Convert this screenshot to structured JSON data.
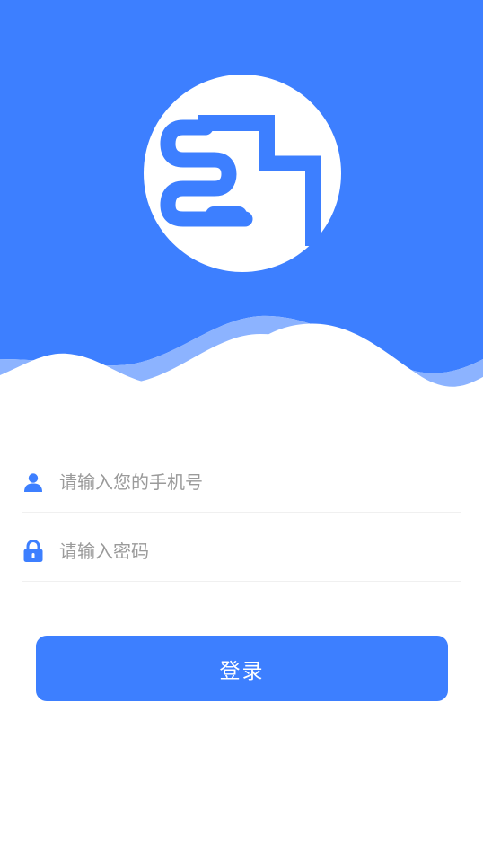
{
  "colors": {
    "primary": "#3d7fff",
    "wave_light": "#8cb3ff",
    "background": "#ffffff",
    "placeholder": "#9a9a9a"
  },
  "logo": {
    "icon": "app-logo-icon"
  },
  "form": {
    "phone": {
      "icon": "user-icon",
      "placeholder": "请输入您的手机号",
      "value": ""
    },
    "password": {
      "icon": "lock-icon",
      "placeholder": "请输入密码",
      "value": ""
    }
  },
  "login_button": {
    "label": "登录"
  }
}
